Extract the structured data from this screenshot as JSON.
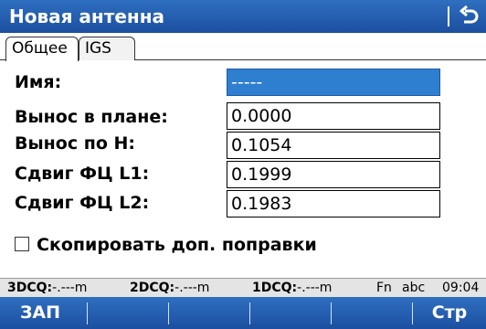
{
  "title": "Новая антенна",
  "tabs": [
    "Общее",
    "IGS"
  ],
  "fields": [
    {
      "label": "Имя:",
      "value": "-----"
    },
    {
      "label": "Вынос в плане:",
      "value": "0.0000"
    },
    {
      "label": "Вынос по Н:",
      "value": "0.1054"
    },
    {
      "label": "Сдвиг ФЦ L1:",
      "value": "0.1999"
    },
    {
      "label": "Сдвиг ФЦ L2:",
      "value": "0.1983"
    }
  ],
  "checkbox": {
    "label": "Скопировать доп. поправки",
    "checked": false
  },
  "status": {
    "dcq3_label": "3DCQ:",
    "dcq3_value": "-.---m",
    "dcq2_label": "2DCQ:",
    "dcq2_value": "-.---m",
    "dcq1_label": "1DCQ:",
    "dcq1_value": "-.---m",
    "fn": "Fn",
    "input_mode": "abc",
    "time": "09:04"
  },
  "softkeys": {
    "f1": "ЗАП",
    "f6": "Стр"
  },
  "icons": {
    "back": "back-arrow-icon",
    "checkbox": "checkbox-unchecked-icon"
  },
  "colors": {
    "bar": "#1c4fa0",
    "selected_field": "#2f7fd0",
    "status_bg": "#e4e4e4"
  }
}
